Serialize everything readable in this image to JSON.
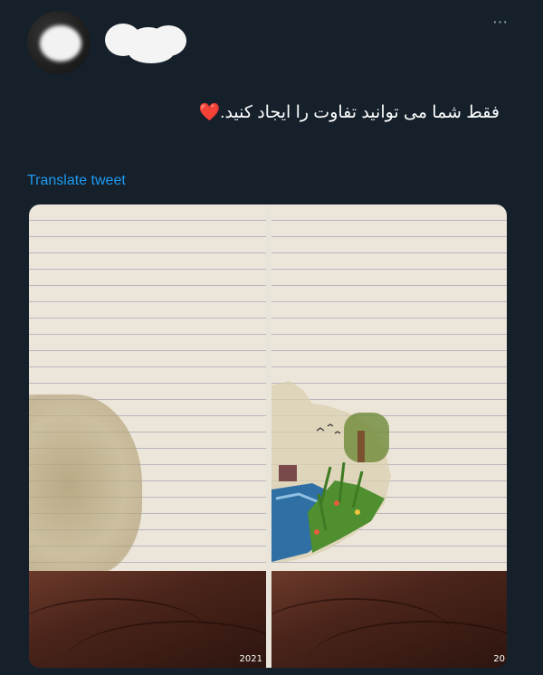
{
  "tweet": {
    "text": "فقط شما می توانید تفاوت را ایجاد کنید.❤️",
    "translate_label": "Translate tweet",
    "more_label": "···"
  },
  "media": {
    "left_caption": "2021",
    "right_caption": "20"
  },
  "colors": {
    "background": "#15202b",
    "link": "#1d9bf0",
    "text": "#ffffff"
  },
  "icons": [
    "more-options-icon",
    "heart-emoji"
  ]
}
